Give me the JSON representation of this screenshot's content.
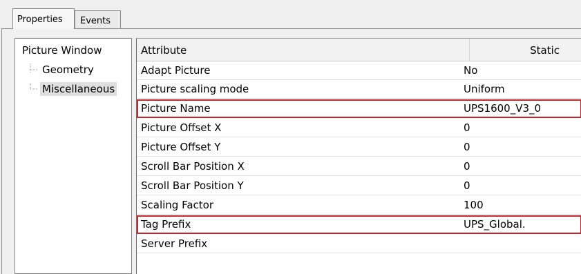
{
  "tabs": [
    {
      "label": "Properties",
      "active": true
    },
    {
      "label": "Events",
      "active": false
    }
  ],
  "tree": {
    "root": "Picture Window",
    "children": [
      {
        "label": "Geometry",
        "selected": false
      },
      {
        "label": "Miscellaneous",
        "selected": true
      }
    ]
  },
  "grid": {
    "header": {
      "attribute": "Attribute",
      "static": "Static"
    },
    "rows": [
      {
        "name": "Adapt Picture",
        "value": "No",
        "highlighted": false
      },
      {
        "name": "Picture scaling mode",
        "value": "Uniform",
        "highlighted": false
      },
      {
        "name": "Picture Name",
        "value": "UPS1600_V3_0",
        "highlighted": true
      },
      {
        "name": "Picture Offset X",
        "value": "0",
        "highlighted": false
      },
      {
        "name": "Picture Offset Y",
        "value": "0",
        "highlighted": false
      },
      {
        "name": "Scroll Bar Position X",
        "value": "0",
        "highlighted": false
      },
      {
        "name": "Scroll Bar Position Y",
        "value": "0",
        "highlighted": false
      },
      {
        "name": "Scaling Factor",
        "value": "100",
        "highlighted": false
      },
      {
        "name": "Tag Prefix",
        "value": "UPS_Global.",
        "highlighted": true
      },
      {
        "name": "Server Prefix",
        "value": "",
        "highlighted": false
      }
    ]
  },
  "colors": {
    "highlight_border": "#c8262c",
    "selected_tree_item": "#dedede",
    "header_background": "#f2f2f2"
  }
}
